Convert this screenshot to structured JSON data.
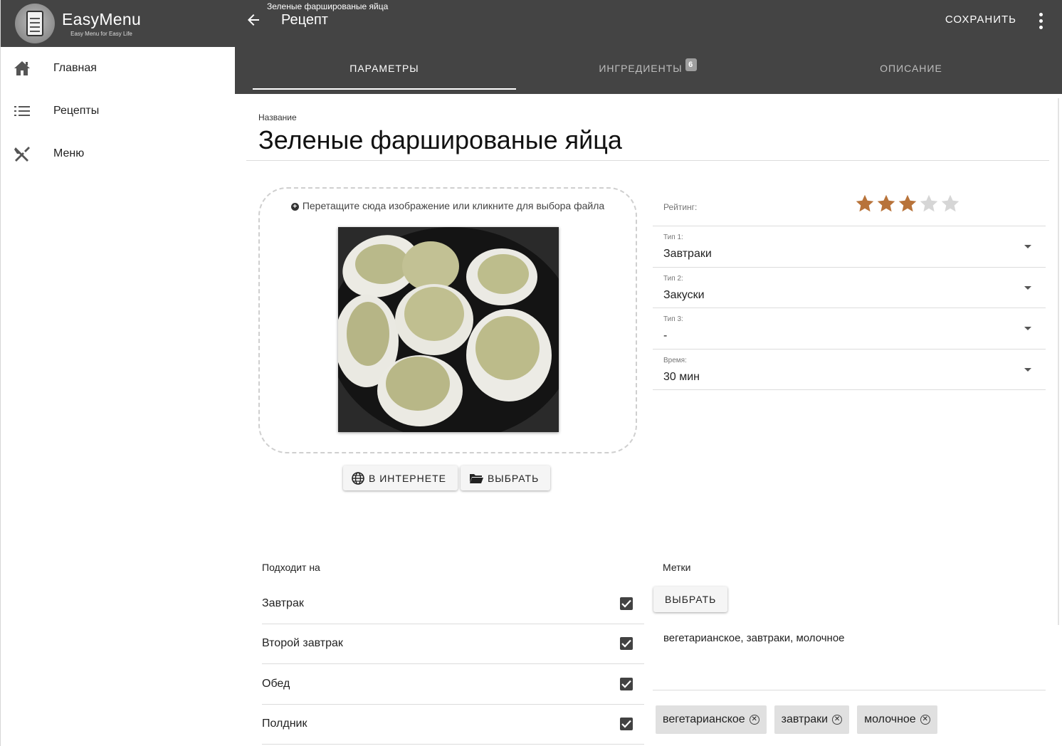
{
  "app": {
    "name": "EasyMenu",
    "tagline": "Easy Menu for Easy Life"
  },
  "sidebar": {
    "items": [
      {
        "label": "Главная",
        "icon": "home-icon"
      },
      {
        "label": "Рецепты",
        "icon": "list-icon"
      },
      {
        "label": "Меню",
        "icon": "utensils-icon"
      }
    ]
  },
  "header": {
    "subtitle": "Зеленые фаршированые яйца",
    "title": "Рецепт",
    "save_label": "СОХРАНИТЬ"
  },
  "tabs": [
    {
      "label": "ПАРАМЕТРЫ",
      "active": true
    },
    {
      "label": "ИНГРЕДИЕНТЫ",
      "badge": "6",
      "active": false
    },
    {
      "label": "ОПИСАНИЕ",
      "active": false
    }
  ],
  "recipe": {
    "name_label": "Название",
    "name": "Зеленые фаршированые яйца"
  },
  "image": {
    "drop_hint": "Перетащите сюда изображение или кликните для выбора файла",
    "internet_label": "В ИНТЕРНЕТЕ",
    "choose_label": "ВЫБРАТЬ"
  },
  "form": {
    "rating_label": "Рейтинг:",
    "rating": 3,
    "rating_max": 5,
    "type1": {
      "label": "Тип 1:",
      "value": "Завтраки"
    },
    "type2": {
      "label": "Тип 2:",
      "value": "Закуски"
    },
    "type3": {
      "label": "Тип 3:",
      "value": "-"
    },
    "time": {
      "label": "Время:",
      "value": "30 мин"
    }
  },
  "suitable": {
    "title": "Подходит на",
    "items": [
      {
        "label": "Завтрак",
        "checked": true
      },
      {
        "label": "Второй завтрак",
        "checked": true
      },
      {
        "label": "Обед",
        "checked": true
      },
      {
        "label": "Полдник",
        "checked": true
      }
    ]
  },
  "tags": {
    "title": "Метки",
    "choose_label": "ВЫБРАТЬ",
    "text": "вегетарианское, завтраки, молочное",
    "chips": [
      "вегетарианское",
      "завтраки",
      "молочное"
    ]
  },
  "colors": {
    "header_bg": "#444444",
    "star_filled": "#b8733a",
    "star_empty": "#d6d6d6"
  }
}
